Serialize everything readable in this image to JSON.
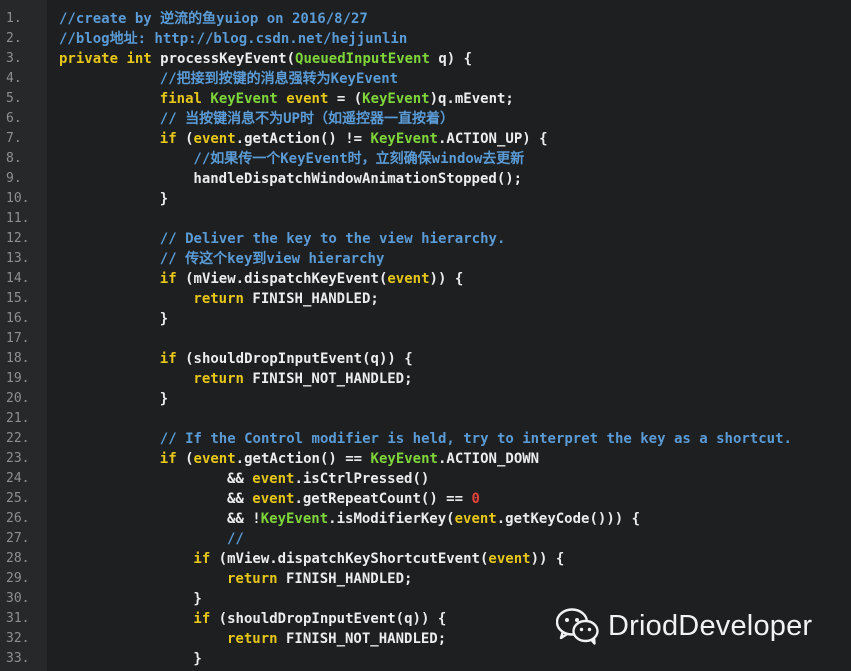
{
  "editor": {
    "lines": [
      {
        "num": "1.",
        "indent": 0,
        "tokens": [
          {
            "t": "//create by 逆流的鱼yuiop on 2016/8/27",
            "c": "comment"
          }
        ]
      },
      {
        "num": "2.",
        "indent": 0,
        "tokens": [
          {
            "t": "//blog地址: http://blog.csdn.net/hejjunlin",
            "c": "comment"
          }
        ]
      },
      {
        "num": "3.",
        "indent": 0,
        "tokens": [
          {
            "t": "private",
            "c": "keyword"
          },
          {
            "t": " "
          },
          {
            "t": "int",
            "c": "keyword"
          },
          {
            "t": " processKeyEvent("
          },
          {
            "t": "QueuedInputEvent",
            "c": "type"
          },
          {
            "t": " q) {"
          }
        ]
      },
      {
        "num": "4.",
        "indent": 12,
        "tokens": [
          {
            "t": "//把接到按键的消息强转为KeyEvent",
            "c": "comment"
          }
        ]
      },
      {
        "num": "5.",
        "indent": 12,
        "tokens": [
          {
            "t": "final",
            "c": "keyword"
          },
          {
            "t": " "
          },
          {
            "t": "KeyEvent",
            "c": "type"
          },
          {
            "t": " "
          },
          {
            "t": "event",
            "c": "keyword"
          },
          {
            "t": " = ("
          },
          {
            "t": "KeyEvent",
            "c": "type"
          },
          {
            "t": ")q.mEvent;"
          }
        ]
      },
      {
        "num": "6.",
        "indent": 12,
        "tokens": [
          {
            "t": "// 当按键消息不为UP时（如遥控器一直按着）",
            "c": "comment"
          }
        ]
      },
      {
        "num": "7.",
        "indent": 12,
        "tokens": [
          {
            "t": "if",
            "c": "keyword"
          },
          {
            "t": " ("
          },
          {
            "t": "event",
            "c": "keyword"
          },
          {
            "t": ".getAction() != "
          },
          {
            "t": "KeyEvent",
            "c": "type"
          },
          {
            "t": ".ACTION_UP) {"
          }
        ]
      },
      {
        "num": "8.",
        "indent": 16,
        "tokens": [
          {
            "t": "//如果传一个KeyEvent时，立刻确保window去更新",
            "c": "comment"
          }
        ]
      },
      {
        "num": "9.",
        "indent": 16,
        "tokens": [
          {
            "t": "handleDispatchWindowAnimationStopped();"
          }
        ]
      },
      {
        "num": "10.",
        "indent": 12,
        "tokens": [
          {
            "t": "}"
          }
        ]
      },
      {
        "num": "11.",
        "indent": 0,
        "tokens": []
      },
      {
        "num": "12.",
        "indent": 12,
        "tokens": [
          {
            "t": "// Deliver the key to the view hierarchy.",
            "c": "comment"
          }
        ]
      },
      {
        "num": "13.",
        "indent": 12,
        "tokens": [
          {
            "t": "// 传这个key到view hierarchy",
            "c": "comment"
          }
        ]
      },
      {
        "num": "14.",
        "indent": 12,
        "tokens": [
          {
            "t": "if",
            "c": "keyword"
          },
          {
            "t": " (mView.dispatchKeyEvent("
          },
          {
            "t": "event",
            "c": "keyword"
          },
          {
            "t": ")) {"
          }
        ]
      },
      {
        "num": "15.",
        "indent": 16,
        "tokens": [
          {
            "t": "return",
            "c": "keyword"
          },
          {
            "t": " FINISH_HANDLED;"
          }
        ]
      },
      {
        "num": "16.",
        "indent": 12,
        "tokens": [
          {
            "t": "}"
          }
        ]
      },
      {
        "num": "17.",
        "indent": 0,
        "tokens": []
      },
      {
        "num": "18.",
        "indent": 12,
        "tokens": [
          {
            "t": "if",
            "c": "keyword"
          },
          {
            "t": " (shouldDropInputEvent(q)) {"
          }
        ]
      },
      {
        "num": "19.",
        "indent": 16,
        "tokens": [
          {
            "t": "return",
            "c": "keyword"
          },
          {
            "t": " FINISH_NOT_HANDLED;"
          }
        ]
      },
      {
        "num": "20.",
        "indent": 12,
        "tokens": [
          {
            "t": "}"
          }
        ]
      },
      {
        "num": "21.",
        "indent": 0,
        "tokens": []
      },
      {
        "num": "22.",
        "indent": 12,
        "tokens": [
          {
            "t": "// If the Control modifier is held, try to interpret the key as a shortcut.",
            "c": "comment"
          }
        ]
      },
      {
        "num": "23.",
        "indent": 12,
        "tokens": [
          {
            "t": "if",
            "c": "keyword"
          },
          {
            "t": " ("
          },
          {
            "t": "event",
            "c": "keyword"
          },
          {
            "t": ".getAction() == "
          },
          {
            "t": "KeyEvent",
            "c": "type"
          },
          {
            "t": ".ACTION_DOWN"
          }
        ]
      },
      {
        "num": "24.",
        "indent": 20,
        "tokens": [
          {
            "t": "&& "
          },
          {
            "t": "event",
            "c": "keyword"
          },
          {
            "t": ".isCtrlPressed()"
          }
        ]
      },
      {
        "num": "25.",
        "indent": 20,
        "tokens": [
          {
            "t": "&& "
          },
          {
            "t": "event",
            "c": "keyword"
          },
          {
            "t": ".getRepeatCount() == "
          },
          {
            "t": "0",
            "c": "number"
          }
        ]
      },
      {
        "num": "26.",
        "indent": 20,
        "tokens": [
          {
            "t": "&& !"
          },
          {
            "t": "KeyEvent",
            "c": "type"
          },
          {
            "t": ".isModifierKey("
          },
          {
            "t": "event",
            "c": "keyword"
          },
          {
            "t": ".getKeyCode())) {"
          }
        ]
      },
      {
        "num": "27.",
        "indent": 20,
        "tokens": [
          {
            "t": "//",
            "c": "comment"
          }
        ]
      },
      {
        "num": "28.",
        "indent": 16,
        "tokens": [
          {
            "t": "if",
            "c": "keyword"
          },
          {
            "t": " (mView.dispatchKeyShortcutEvent("
          },
          {
            "t": "event",
            "c": "keyword"
          },
          {
            "t": ")) {"
          }
        ]
      },
      {
        "num": "29.",
        "indent": 20,
        "tokens": [
          {
            "t": "return",
            "c": "keyword"
          },
          {
            "t": " FINISH_HANDLED;"
          }
        ]
      },
      {
        "num": "30.",
        "indent": 16,
        "tokens": [
          {
            "t": "}"
          }
        ]
      },
      {
        "num": "31.",
        "indent": 16,
        "tokens": [
          {
            "t": "if",
            "c": "keyword"
          },
          {
            "t": " (shouldDropInputEvent(q)) {"
          }
        ]
      },
      {
        "num": "32.",
        "indent": 20,
        "tokens": [
          {
            "t": "return",
            "c": "keyword"
          },
          {
            "t": " FINISH_NOT_HANDLED;"
          }
        ]
      },
      {
        "num": "33.",
        "indent": 16,
        "tokens": [
          {
            "t": "}"
          }
        ]
      }
    ]
  },
  "watermark": {
    "icon": "wechat-icon",
    "text": "DriodDeveloper"
  },
  "colors": {
    "background": "#1d1f21",
    "gutter": "#26282a",
    "comment": "#5b9bd5",
    "keyword": "#e6c619",
    "type": "#7fd63a",
    "number": "#e8443a",
    "plain": "#ececec",
    "line_number": "#8f8f8f"
  }
}
